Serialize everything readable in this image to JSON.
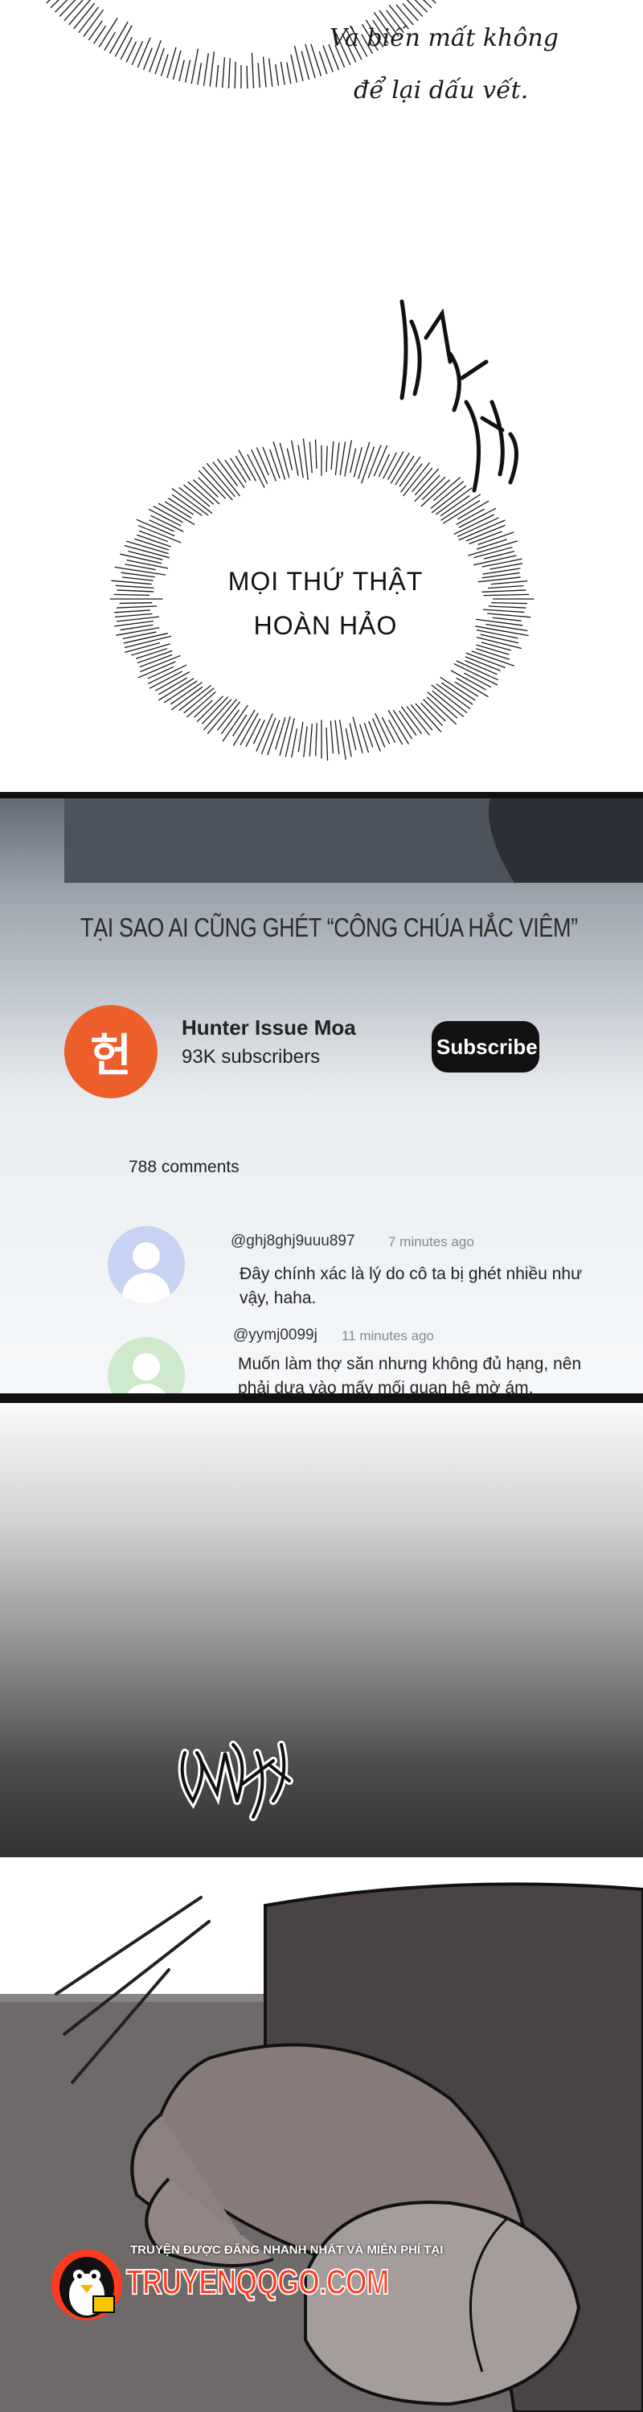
{
  "panel1": {
    "narration_line1": "Và biến mất không",
    "narration_line2": "để lại dấu vết.",
    "speech_line1": "MỌI THỨ THẬT",
    "speech_line2": "HOÀN HẢO"
  },
  "video_screen": {
    "title": "TẠI SAO AI CŨNG GHÉT “CÔNG CHÚA HẮC VIÊM”",
    "channel": {
      "logo_glyph": "헌",
      "name": "Hunter Issue Moa",
      "subscribers": "93K subscribers",
      "subscribe_label": "Subscribe"
    },
    "comment_count": "788 comments",
    "comments": [
      {
        "handle": "@ghj8ghj9uuu897",
        "time": "7 minutes ago",
        "line1": "Đây chính xác là lý do cô ta bị ghét nhiều như",
        "line2": "vậy, haha.",
        "avatar_color": "#c7d3f2"
      },
      {
        "handle": "@yymj0099j",
        "time": "11 minutes ago",
        "line1": "Muốn làm thợ săn nhưng không đủ hạng, nên",
        "line2": "phải dựa vào mấy mối quan hệ mờ ám.",
        "avatar_color": "#cfe9cd"
      }
    ]
  },
  "watermark": {
    "tagline": "TRUYỆN ĐƯỢC ĐĂNG NHANH NHẤT VÀ MIỄN PHÍ TẠI",
    "site": "TRUYENQQGO.COM"
  },
  "colors": {
    "channel_logo": "#ec5f2a",
    "watermark_red": "#ff3b1f"
  }
}
